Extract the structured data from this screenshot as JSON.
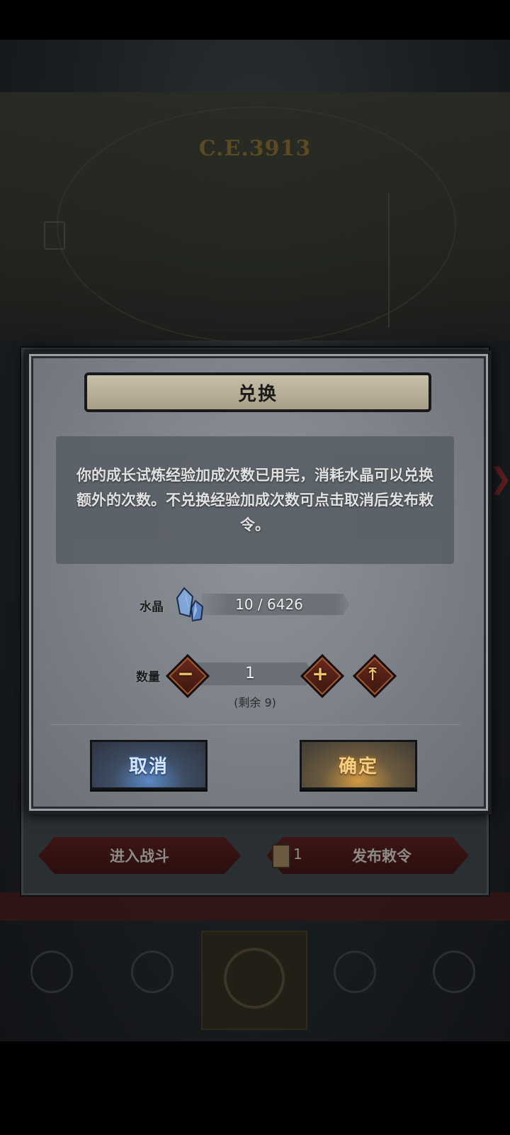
{
  "dialog": {
    "title": "兑换",
    "message": "你的成长试炼经验加成次数已用完，消耗水晶可以兑换额外的次数。不兑换经验加成次数可点击取消后发布敕令。",
    "crystal": {
      "label": "水晶",
      "value": "10 / 6426",
      "icon": "crystal-icon"
    },
    "quantity": {
      "label": "数量",
      "value": "1",
      "minus_icon": "minus-icon",
      "plus_icon": "plus-icon",
      "max_icon": "max-arrow-icon",
      "remaining": "(剩余 9)"
    },
    "cancel_label": "取消",
    "confirm_label": "确定"
  },
  "background": {
    "ce_text": "C.E.3913",
    "enter_battle_label": "进入战斗",
    "publish_label": "发布敕令",
    "publish_count": "1",
    "colors": {
      "dialog": "#7a8086",
      "cancel_glow": "#5c89c6",
      "confirm_glow": "#d19a43",
      "accent_gold": "#f1c36a"
    }
  }
}
